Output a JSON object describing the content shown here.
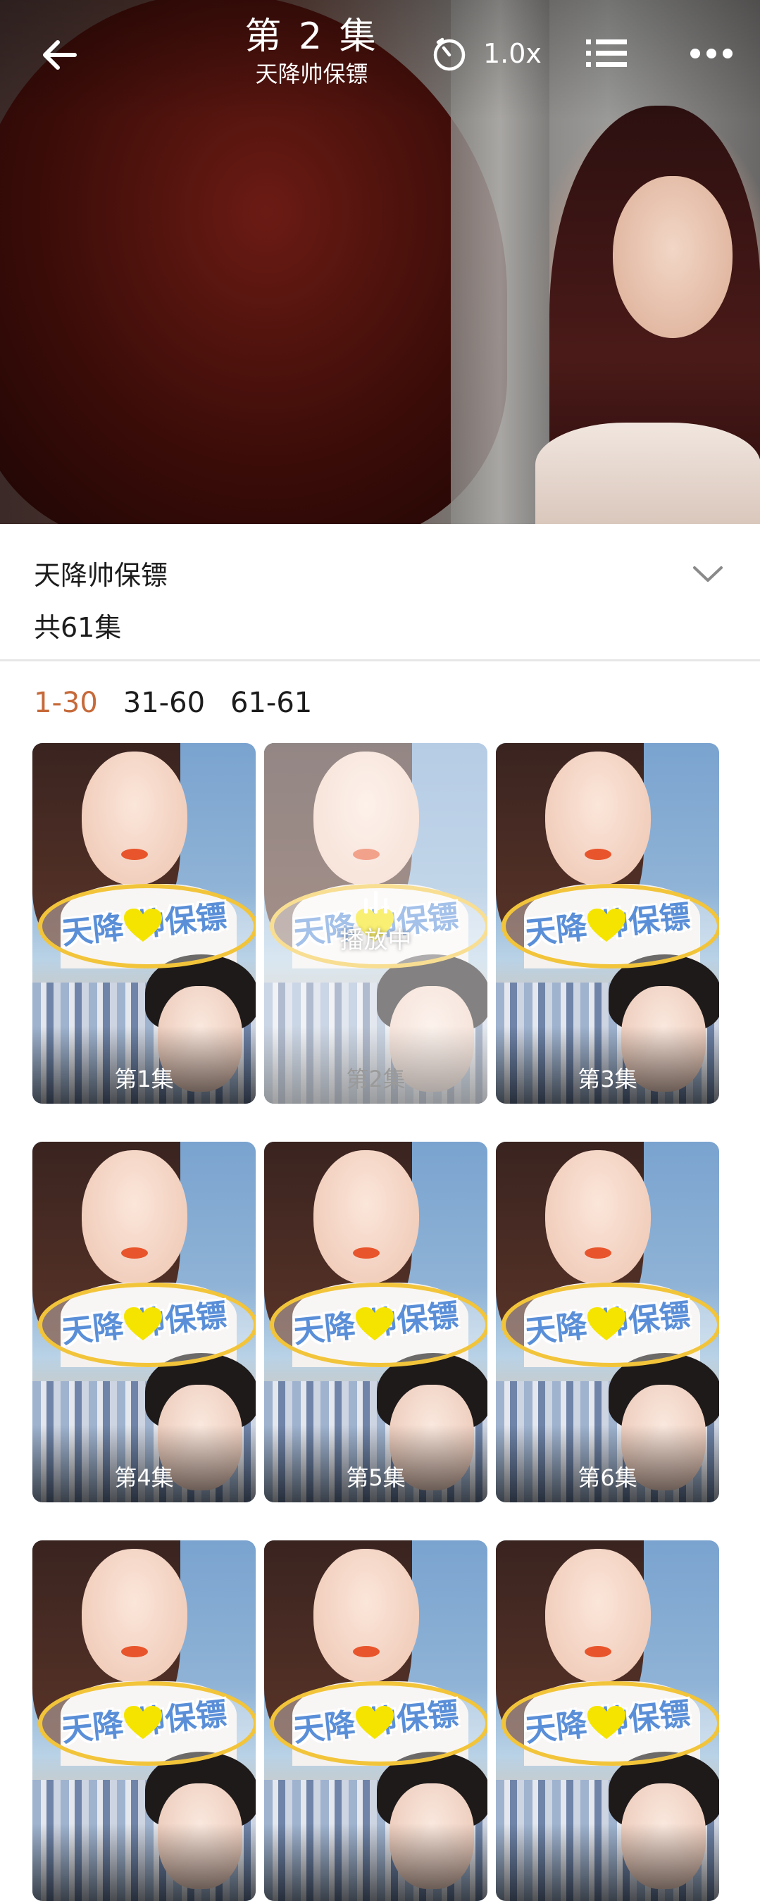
{
  "player": {
    "title": "第 2 集",
    "subtitle": "天降帅保镖",
    "speed": "1.0x",
    "icons": {
      "back": "back-arrow-icon",
      "timer": "timer-icon",
      "list": "playlist-icon",
      "more": "more-icon"
    }
  },
  "info": {
    "show_title": "天降帅保镖",
    "episode_count": "共61集",
    "expand_icon": "chevron-down-icon"
  },
  "tabs": [
    {
      "label": "1-30",
      "active": true
    },
    {
      "label": "31-60",
      "active": false
    },
    {
      "label": "61-61",
      "active": false
    }
  ],
  "episodes": {
    "logo_text": "天降   帅保镖",
    "playing_label": "播放中",
    "items": [
      {
        "label": "第1集",
        "playing": false
      },
      {
        "label": "第2集",
        "playing": true
      },
      {
        "label": "第3集",
        "playing": false
      },
      {
        "label": "第4集",
        "playing": false
      },
      {
        "label": "第5集",
        "playing": false
      },
      {
        "label": "第6集",
        "playing": false
      },
      {
        "label": "",
        "playing": false
      },
      {
        "label": "",
        "playing": false
      },
      {
        "label": "",
        "playing": false
      }
    ]
  },
  "colors": {
    "accent": "#c66a3a",
    "text": "#1c1c1c",
    "divider": "#e7e7e7"
  }
}
